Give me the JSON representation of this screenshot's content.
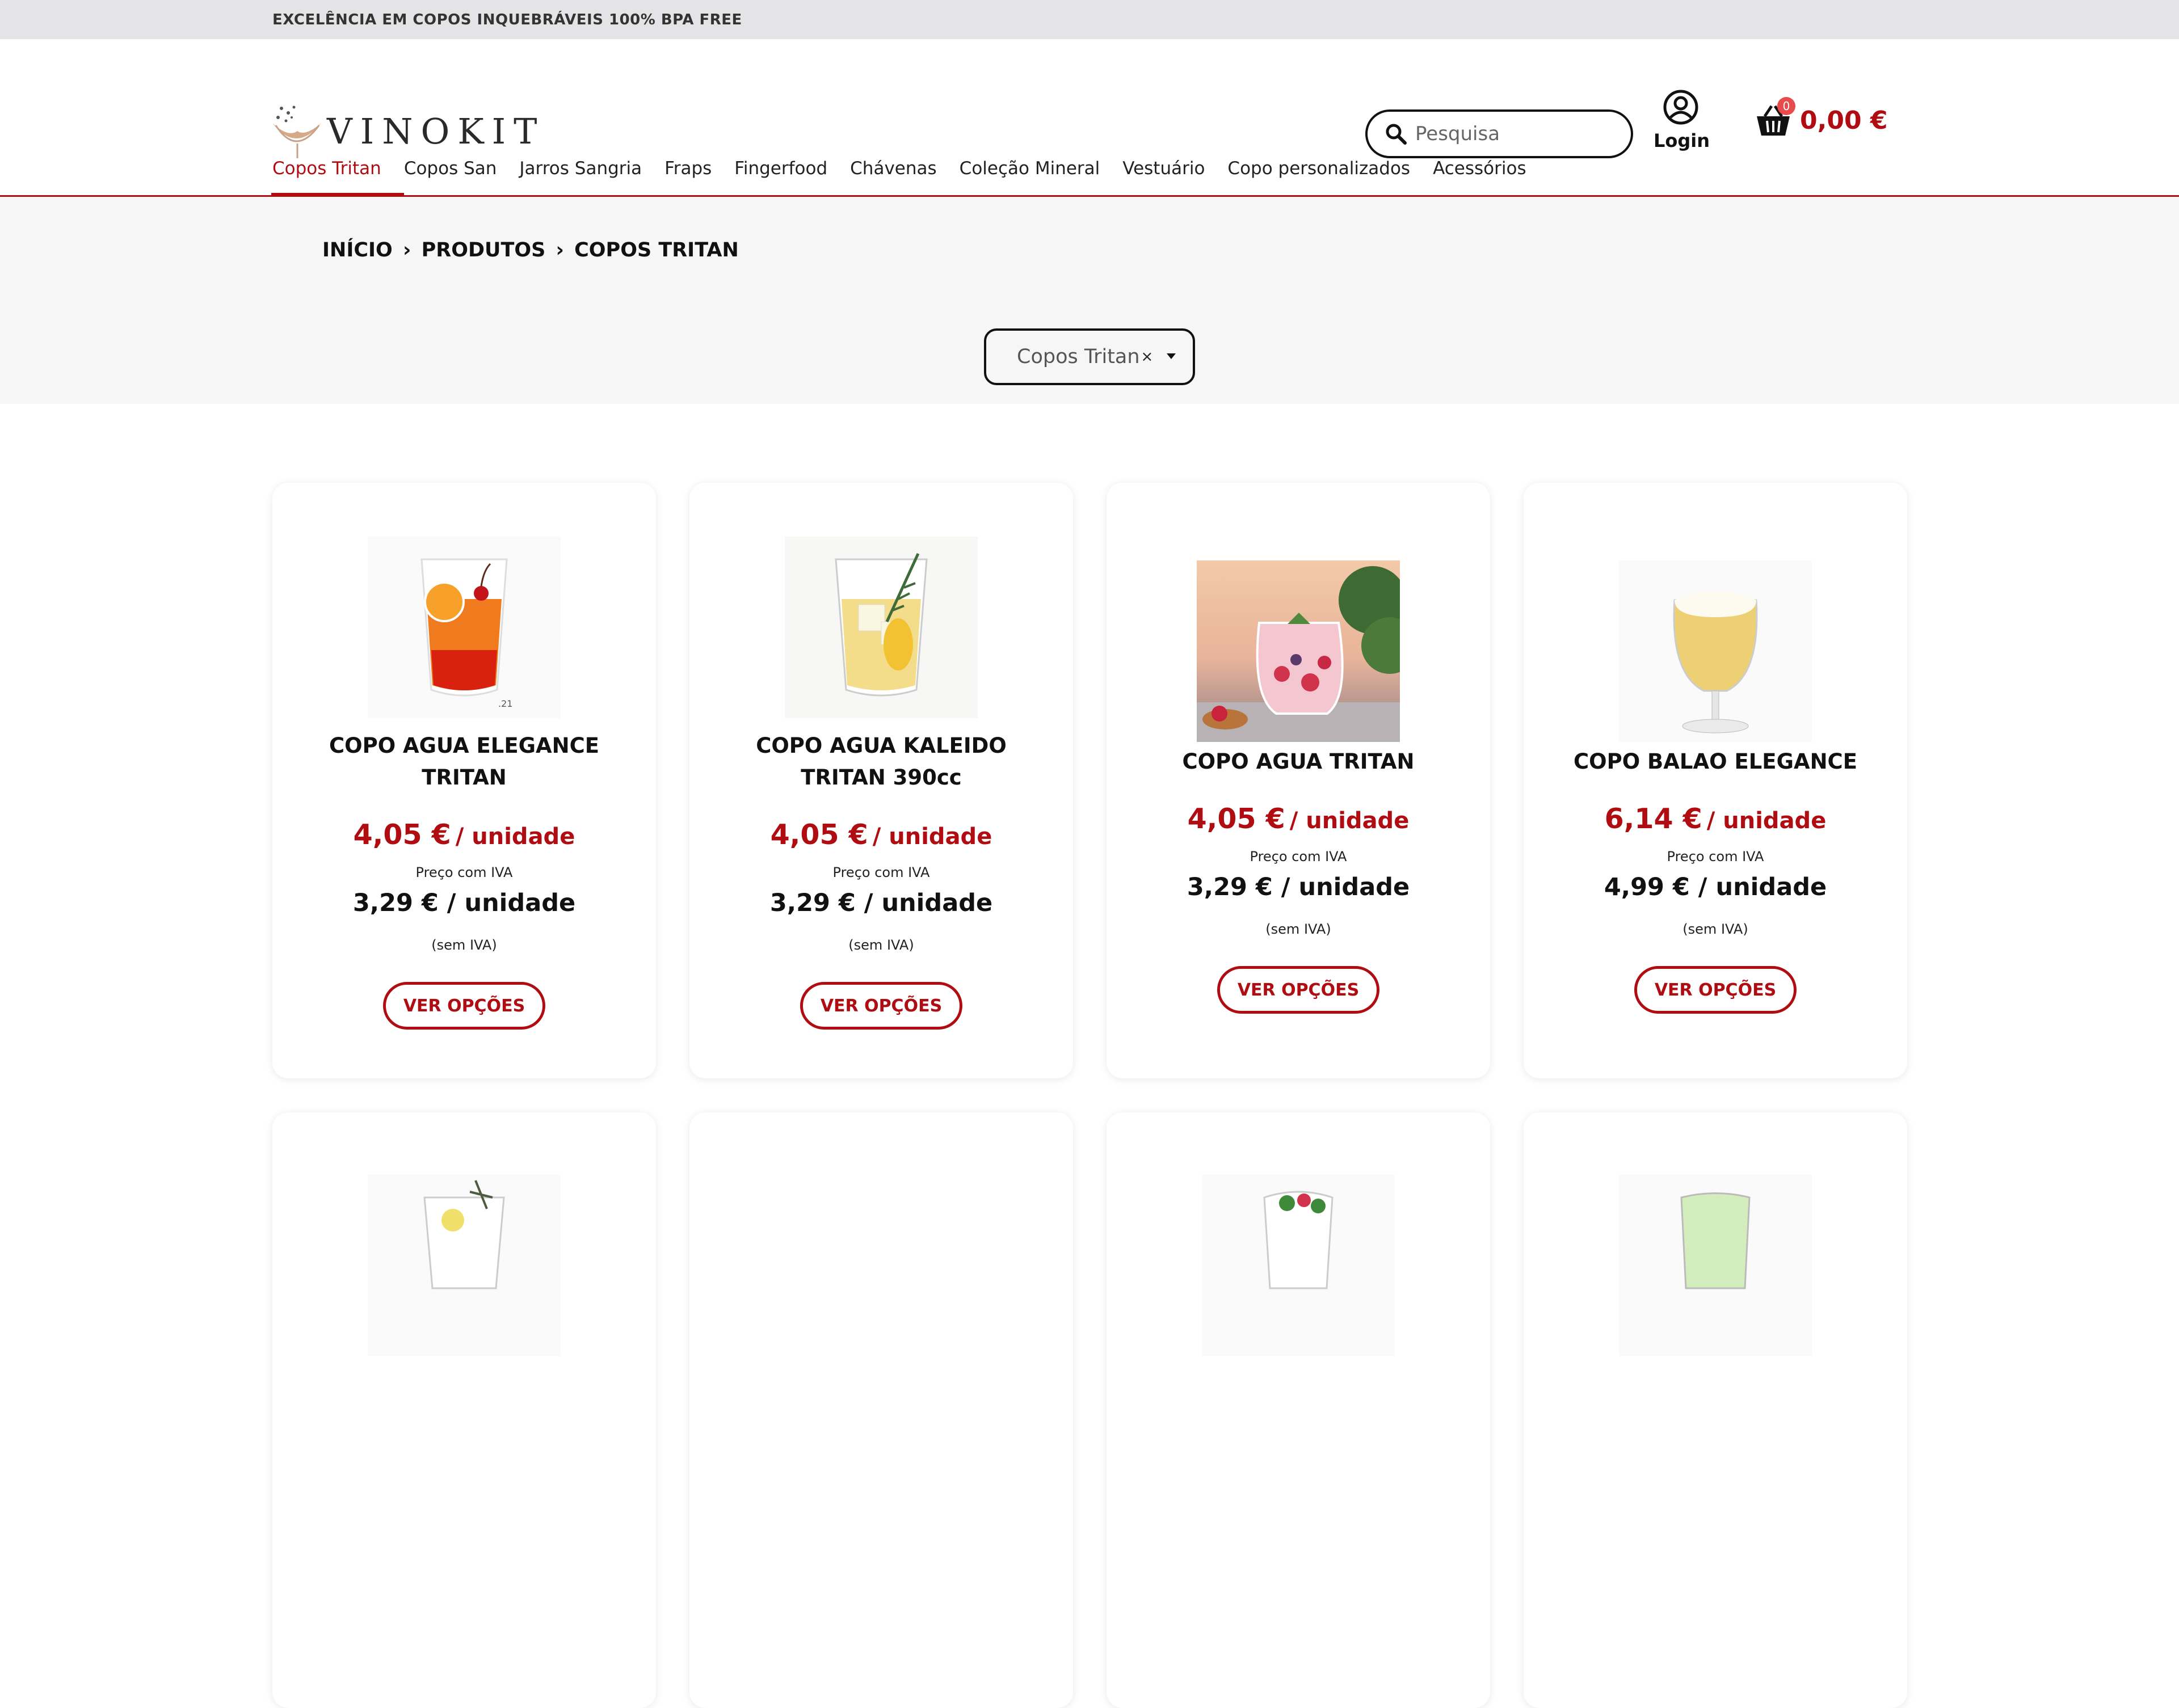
{
  "topbar": {
    "text": "EXCELÊNCIA EM COPOS INQUEBRÁVEIS 100% BPA FREE"
  },
  "brand": {
    "name": "VINOKIT",
    "accent": "#b00d12"
  },
  "search": {
    "placeholder": "Pesquisa",
    "icon": "search-icon"
  },
  "login": {
    "label": "Login",
    "icon": "user-circle-icon"
  },
  "cart": {
    "count": "0",
    "total": "0,00 €",
    "icon": "basket-icon"
  },
  "nav": [
    "Copos Tritan",
    "Copos San",
    "Jarros Sangria",
    "Fraps",
    "Fingerfood",
    "Chávenas",
    "Coleção Mineral",
    "Vestuário",
    "Copo personalizados",
    "Acessórios"
  ],
  "breadcrumb": [
    "INÍCIO",
    "PRODUTOS",
    "COPOS TRITAN"
  ],
  "filter": {
    "value": "Copos Tritan",
    "clear": "×"
  },
  "products": [
    {
      "title": "COPO AGUA ELEGANCE TRITAN",
      "price_iva": "4,05 €",
      "unit": "/ unidade",
      "iva_label": "Preço com IVA",
      "price_sem": "3,29 € / unidade",
      "sem_label": "(sem IVA)",
      "button": "VER OPÇÕES"
    },
    {
      "title": "COPO AGUA KALEIDO TRITAN 390cc",
      "price_iva": "4,05 €",
      "unit": "/ unidade",
      "iva_label": "Preço com IVA",
      "price_sem": "3,29 € / unidade",
      "sem_label": "(sem IVA)",
      "button": "VER OPÇÕES"
    },
    {
      "title": "COPO AGUA TRITAN",
      "price_iva": "4,05 €",
      "unit": "/ unidade",
      "iva_label": "Preço com IVA",
      "price_sem": "3,29 € / unidade",
      "sem_label": "(sem IVA)",
      "button": "VER OPÇÕES"
    },
    {
      "title": "COPO BALAO ELEGANCE",
      "price_iva": "6,14 €",
      "unit": "/ unidade",
      "iva_label": "Preço com IVA",
      "price_sem": "4,99 € / unidade",
      "sem_label": "(sem IVA)",
      "button": "VER OPÇÕES"
    }
  ],
  "image_watermark": ".21"
}
